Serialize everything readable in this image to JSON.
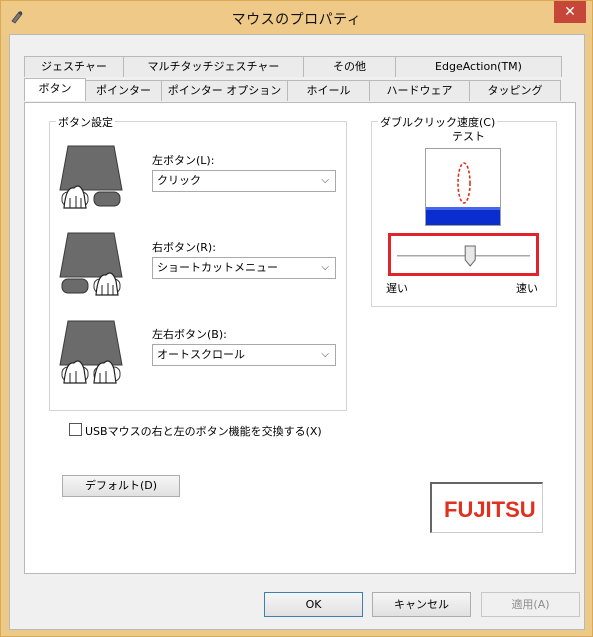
{
  "window": {
    "title": "マウスのプロパティ",
    "close_glyph": "✕"
  },
  "tabs": {
    "row_back": [
      "ジェスチャー",
      "マルチタッチジェスチャー",
      "その他",
      "EdgeAction(TM)"
    ],
    "row_front": [
      "ボタン",
      "ポインター",
      "ポインター オプション",
      "ホイール",
      "ハードウェア",
      "タッピング"
    ],
    "active": "ボタン"
  },
  "button_settings": {
    "group_label": "ボタン設定",
    "left": {
      "label": "左ボタン(L):",
      "value": "クリック"
    },
    "right": {
      "label": "右ボタン(R):",
      "value": "ショートカットメニュー"
    },
    "both": {
      "label": "左右ボタン(B):",
      "value": "オートスクロール"
    }
  },
  "double_click": {
    "group_label": "ダブルクリック速度(C)",
    "test_label": "テスト",
    "slow_label": "遅い",
    "fast_label": "速い",
    "slider_level": 0.55
  },
  "swap_checkbox": {
    "label": "USBマウスの右と左のボタン機能を交換する(X)",
    "checked": false
  },
  "default_button": "デフォルト(D)",
  "logo_text": "FUJITSU",
  "footer": {
    "ok": "OK",
    "cancel": "キャンセル",
    "apply": "適用(A)"
  },
  "colors": {
    "accent_red": "#e3232c",
    "title_bar": "#efc988",
    "logo_red": "#e0301e",
    "progress_blue": "#0a2dd0"
  }
}
